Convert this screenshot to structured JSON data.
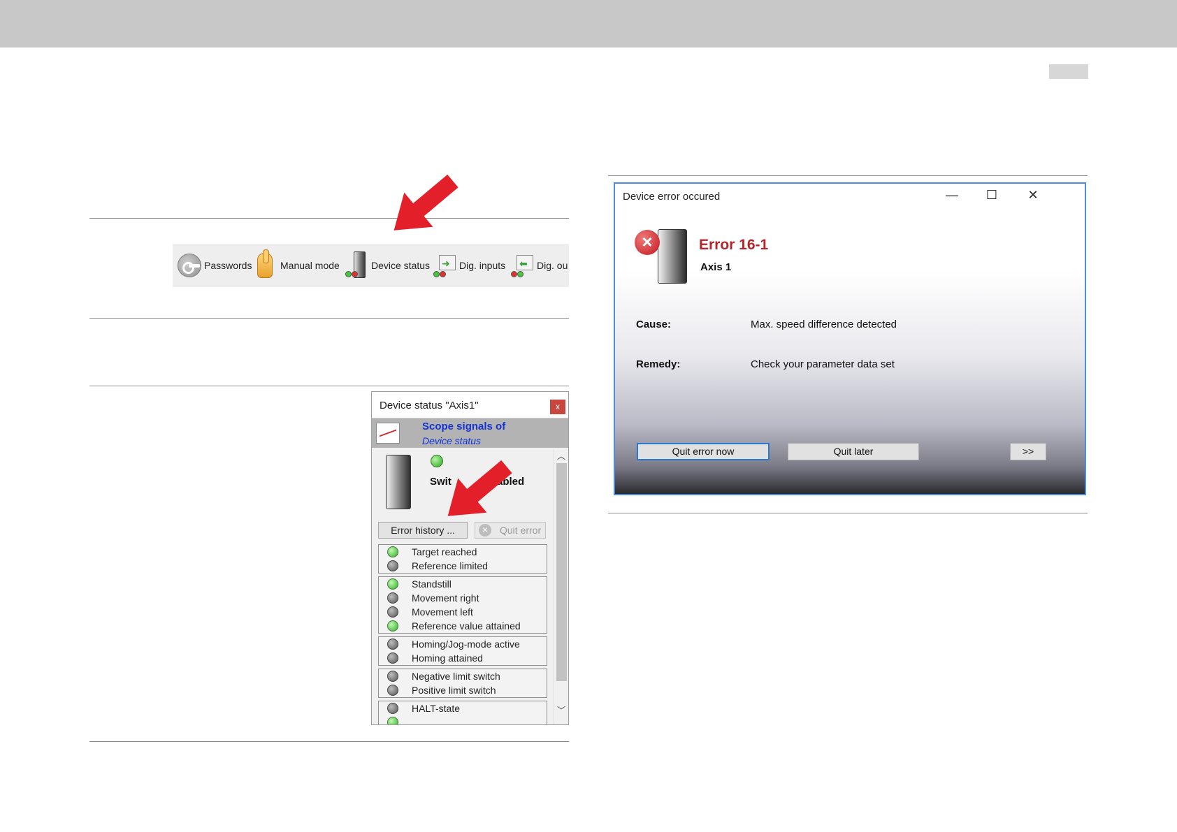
{
  "toolbar": {
    "items": [
      {
        "label": "Passwords",
        "icon": "key-icon"
      },
      {
        "label": "Manual mode",
        "icon": "hand-icon"
      },
      {
        "label": "Device status",
        "icon": "device-tower-icon"
      },
      {
        "label": "Dig. inputs",
        "icon": "digital-input-icon"
      },
      {
        "label": "Dig. ou",
        "icon": "digital-output-icon"
      }
    ]
  },
  "device_status": {
    "title": "Device status \"Axis1\"",
    "close_label": "x",
    "scope_title": "Scope signals of",
    "scope_subtitle": "Device status",
    "state_left": "Swit",
    "state_right": "abled",
    "error_history_label": "Error history ...",
    "quit_error_label": "Quit error",
    "groups": [
      [
        {
          "label": "Target reached",
          "on": true
        },
        {
          "label": "Reference limited",
          "on": false
        }
      ],
      [
        {
          "label": "Standstill",
          "on": true
        },
        {
          "label": "Movement right",
          "on": false
        },
        {
          "label": "Movement left",
          "on": false
        },
        {
          "label": "Reference value attained",
          "on": true
        }
      ],
      [
        {
          "label": "Homing/Jog-mode active",
          "on": false
        },
        {
          "label": "Homing attained",
          "on": false
        }
      ],
      [
        {
          "label": "Negative limit switch",
          "on": false
        },
        {
          "label": "Positive limit switch",
          "on": false
        }
      ],
      [
        {
          "label": "HALT-state",
          "on": false
        }
      ]
    ]
  },
  "error_dialog": {
    "title": "Device error occured",
    "minimize": "—",
    "maximize": "☐",
    "close": "✕",
    "error_code": "Error 16-1",
    "axis": "Axis 1",
    "cause_label": "Cause:",
    "cause_value": "Max. speed difference detected",
    "remedy_label": "Remedy:",
    "remedy_value": "Check your parameter data set",
    "quit_now_label": "Quit error now",
    "quit_later_label": "Quit later",
    "more_label": ">>"
  },
  "colors": {
    "accent_blue": "#2d7ad4",
    "error_red": "#b3262c",
    "arrow_red": "#e3202a",
    "led_green": "#2fb025",
    "led_grey": "#565656"
  }
}
